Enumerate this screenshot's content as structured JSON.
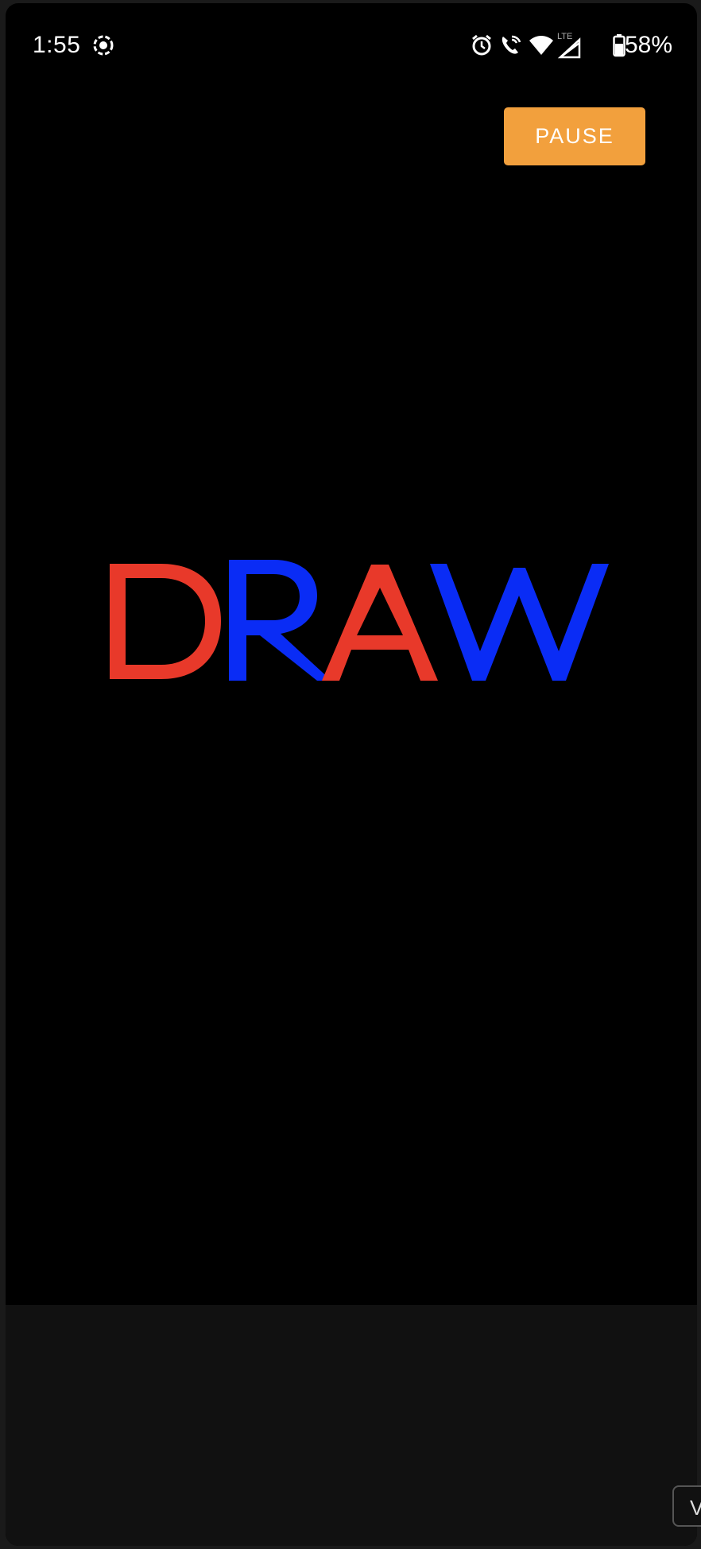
{
  "status_bar": {
    "time": "1:55",
    "battery": "58%",
    "network": "LTE",
    "icons": [
      "screen-record-icon",
      "alarm-icon",
      "wifi-calling-icon",
      "wifi-icon",
      "signal-icon",
      "battery-icon"
    ]
  },
  "controls": {
    "pause_label": "PAUSE"
  },
  "title": {
    "letters": [
      "D",
      "R",
      "A",
      "W"
    ],
    "colors": [
      "#e8392a",
      "#0a2cf5",
      "#e8392a",
      "#0a2cf5"
    ]
  },
  "edge_chip": {
    "label": "V"
  }
}
